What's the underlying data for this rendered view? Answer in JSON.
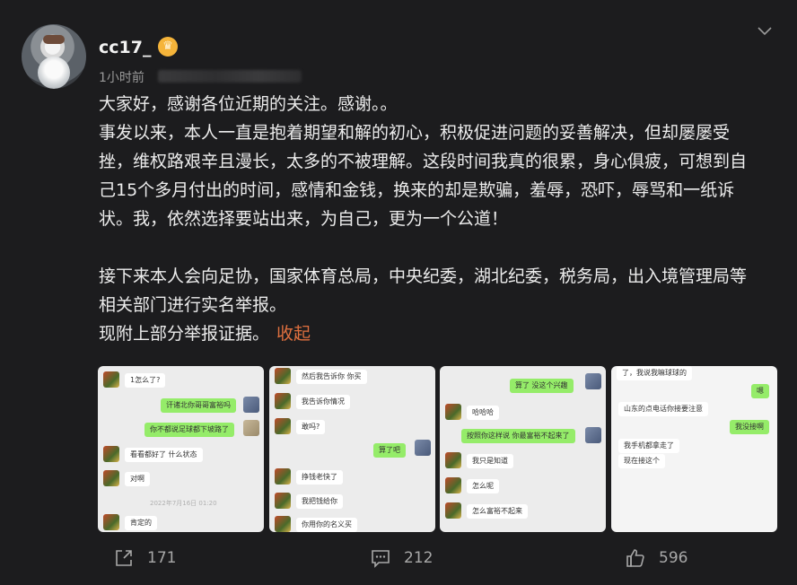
{
  "post": {
    "username": "cc17_",
    "badge_icon": "crown-icon",
    "time": "1小时前",
    "lines": [
      "大家好，感谢各位近期的关注。感谢。。",
      "事发以来，本人一直是抱着期望和解的初心，积极促进问题的妥善解决，但却屡屡受",
      "挫，维权路艰辛且漫长，太多的不被理解。这段时间我真的很累，身心俱疲，可想到自",
      "己15个多月付出的时间，感情和金钱，换来的却是欺骗，羞辱，恐吓，辱骂和一纸诉",
      "状。我，依然选择要站出来，为自己，更为一个公道！",
      "接下来本人会向足协，国家体育总局，中央纪委，湖北纪委，税务局，出入境管理局等",
      "相关部门进行实名举报。",
      "现附上部分举报证据。"
    ],
    "collapse_label": "收起",
    "accent_color": "#e0703f"
  },
  "images": [
    {
      "messages": [
        {
          "side": "l",
          "text": "1怎么了?"
        },
        {
          "side": "r",
          "text": "讦诸北你哥哥富裕吗"
        },
        {
          "side": "r",
          "text": "你不都说足球都下坡路了"
        },
        {
          "side": "l",
          "text": "看看都好了 什么状态"
        },
        {
          "side": "l",
          "text": "对啊"
        },
        {
          "side": "l",
          "text": "肯定的"
        }
      ],
      "timestamp": "2022年7月16日 01:20"
    },
    {
      "messages": [
        {
          "side": "l",
          "text": "然后我告诉你 你买"
        },
        {
          "side": "l",
          "text": "我告诉你情况"
        },
        {
          "side": "l",
          "text": "敢吗?"
        },
        {
          "side": "r",
          "text": "算了吧"
        },
        {
          "side": "l",
          "text": "挣钱老快了"
        },
        {
          "side": "l",
          "text": "我把钱给你"
        },
        {
          "side": "l",
          "text": "你用你的名义买"
        }
      ]
    },
    {
      "messages": [
        {
          "side": "r",
          "text": "算了 没这个兴趣"
        },
        {
          "side": "l",
          "text": "哈哈哈"
        },
        {
          "side": "r",
          "text": "按照你这样说 你最富裕不起来了"
        },
        {
          "side": "l",
          "text": "我只是知道"
        },
        {
          "side": "l",
          "text": "怎么呢"
        },
        {
          "side": "l",
          "text": "怎么富裕不起来"
        }
      ]
    },
    {
      "messages": [
        {
          "side": "l",
          "text": "了，我说我嘛球球的"
        },
        {
          "side": "r",
          "text": "嗯"
        },
        {
          "side": "l",
          "text": "山东的点电话你接要注意"
        },
        {
          "side": "r",
          "text": "我没接啊"
        },
        {
          "side": "l",
          "text": "我手机都拿走了"
        },
        {
          "side": "l",
          "text": "现在接这个"
        }
      ]
    }
  ],
  "actions": {
    "share_icon": "share-icon",
    "share_count": "171",
    "comment_icon": "comment-icon",
    "comment_count": "212",
    "like_icon": "thumbs-up-icon",
    "like_count": "596"
  }
}
